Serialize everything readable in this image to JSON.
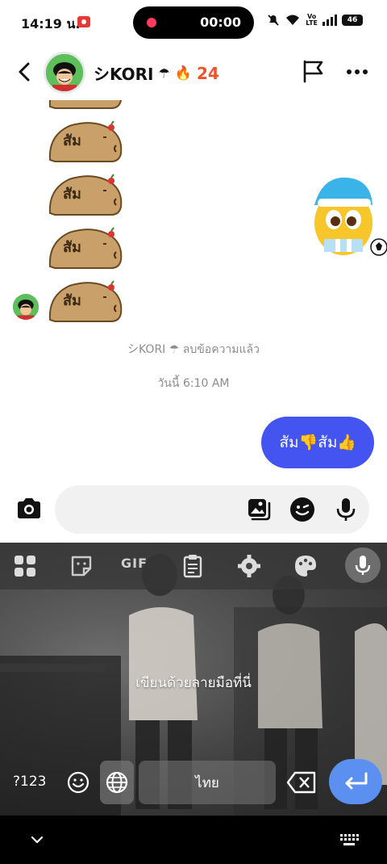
{
  "status_bar": {
    "time": "14:19 น.",
    "record_timer": "00:00",
    "network_label": "Vo\nLTE",
    "battery": "46"
  },
  "header": {
    "contact_name": "シKORI",
    "status_emoji": "☂",
    "streak_emoji": "🔥",
    "streak_count": "24"
  },
  "chat": {
    "stickers": [
      {
        "label": "สัม"
      },
      {
        "label": "สัม"
      },
      {
        "label": "สัม"
      },
      {
        "label": "สัม"
      }
    ],
    "deleted_notice": "シKORI ☂ ลบข้อความแล้ว",
    "timestamp": "วันนี้ 6:10 AM",
    "outgoing_message": "สัม👎สัม👍"
  },
  "composer": {
    "input_value": "",
    "input_placeholder": ""
  },
  "keyboard": {
    "handwriting_hint": "เขียนด้วยลายมือที่นี่",
    "symbols_key": "?123",
    "space_label": "ไทย",
    "gif_label": "GIF"
  },
  "colors": {
    "bubble": "#4354f0",
    "streak": "#f0522a",
    "enter_key": "#5b8ff0"
  }
}
